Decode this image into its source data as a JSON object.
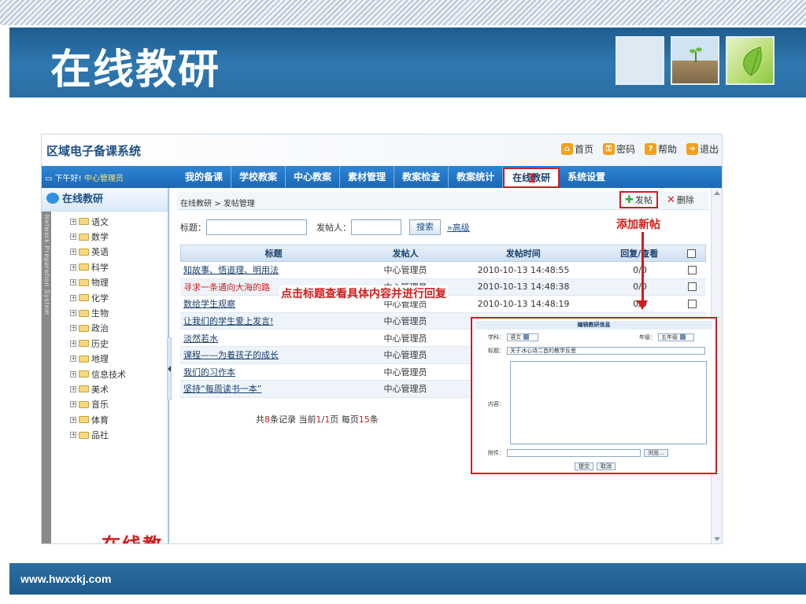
{
  "slide": {
    "title": "在线教研",
    "footer_url": "www.hwxxkj.com"
  },
  "app": {
    "system_title": "区域电子备课系统",
    "top_links": [
      {
        "label": "首页",
        "icon": "home-icon",
        "color": "#f2a01e"
      },
      {
        "label": "密码",
        "icon": "key-icon",
        "color": "#f2a01e"
      },
      {
        "label": "帮助",
        "icon": "help-icon",
        "color": "#f2a01e"
      },
      {
        "label": "退出",
        "icon": "exit-icon",
        "color": "#f2a01e"
      }
    ],
    "greeting": "下午好!",
    "user": "中心管理员",
    "menu": [
      "我的备课",
      "学校教案",
      "中心教案",
      "素材管理",
      "教案检查",
      "教案统计",
      "在线教研",
      "系统设置"
    ],
    "active_menu": "在线教研",
    "annotation_number": "1",
    "sidebar": {
      "title": "在线教研",
      "vertical_text": "Network Preparation System",
      "subjects": [
        "语文",
        "数学",
        "英语",
        "科学",
        "物理",
        "化学",
        "生物",
        "政治",
        "历史",
        "地理",
        "信息技术",
        "美术",
        "音乐",
        "体育",
        "品社"
      ],
      "big_label": "在线教研"
    },
    "breadcrumb": "在线教研 > 发帖管理",
    "buttons": {
      "post": "发帖",
      "delete": "删除",
      "search": "搜索",
      "advanced": "高级"
    },
    "search": {
      "title_label": "标题：",
      "poster_label": "发帖人："
    },
    "annotations": {
      "add_post": "添加新帖",
      "click_title": "点击标题查看具体内容并进行回复"
    },
    "table": {
      "headers": [
        "标题",
        "发帖人",
        "发帖时间",
        "回复/查看"
      ],
      "rows": [
        {
          "title": "知故事、悟道理、明用法",
          "poster": "中心管理员",
          "time": "2010-10-13 14:48:55",
          "reply": "0/0"
        },
        {
          "title": "寻求一条通向大海的路",
          "poster": "中心管理员",
          "time": "2010-10-13 14:48:38",
          "reply": "0/0"
        },
        {
          "title": "数给学生观察",
          "poster": "中心管理员",
          "time": "2010-10-13 14:48:19",
          "reply": "0/0"
        },
        {
          "title": "让我们的学生爱上发言!",
          "poster": "中心管理员",
          "time": "",
          "reply": ""
        },
        {
          "title": "淡然若水",
          "poster": "中心管理员",
          "time": "",
          "reply": ""
        },
        {
          "title": "课程——为着孩子的成长",
          "poster": "中心管理员",
          "time": "",
          "reply": ""
        },
        {
          "title": "我们的习作本",
          "poster": "中心管理员",
          "time": "",
          "reply": ""
        },
        {
          "title": "坚持“每周读书一本”",
          "poster": "中心管理员",
          "time": "",
          "reply": ""
        }
      ]
    },
    "pager": {
      "prefix": "共",
      "total": "8",
      "mid1": "条记录 当前",
      "current": "1",
      "slash": "/",
      "pages": "1",
      "mid2": "页 每页",
      "per_page": "15",
      "suffix": "条"
    },
    "popup": {
      "title": "编辑教研信息",
      "subject_label": "学科：",
      "subject_value": "语文",
      "grade_label": "年级：",
      "grade_value": "五年级",
      "title_label": "标题：",
      "title_value": "关于冰心诗二首的教学反思",
      "content_label": "内容：",
      "attach_label": "附件：",
      "browse": "浏览...",
      "submit": "提交",
      "cancel": "取消"
    }
  }
}
